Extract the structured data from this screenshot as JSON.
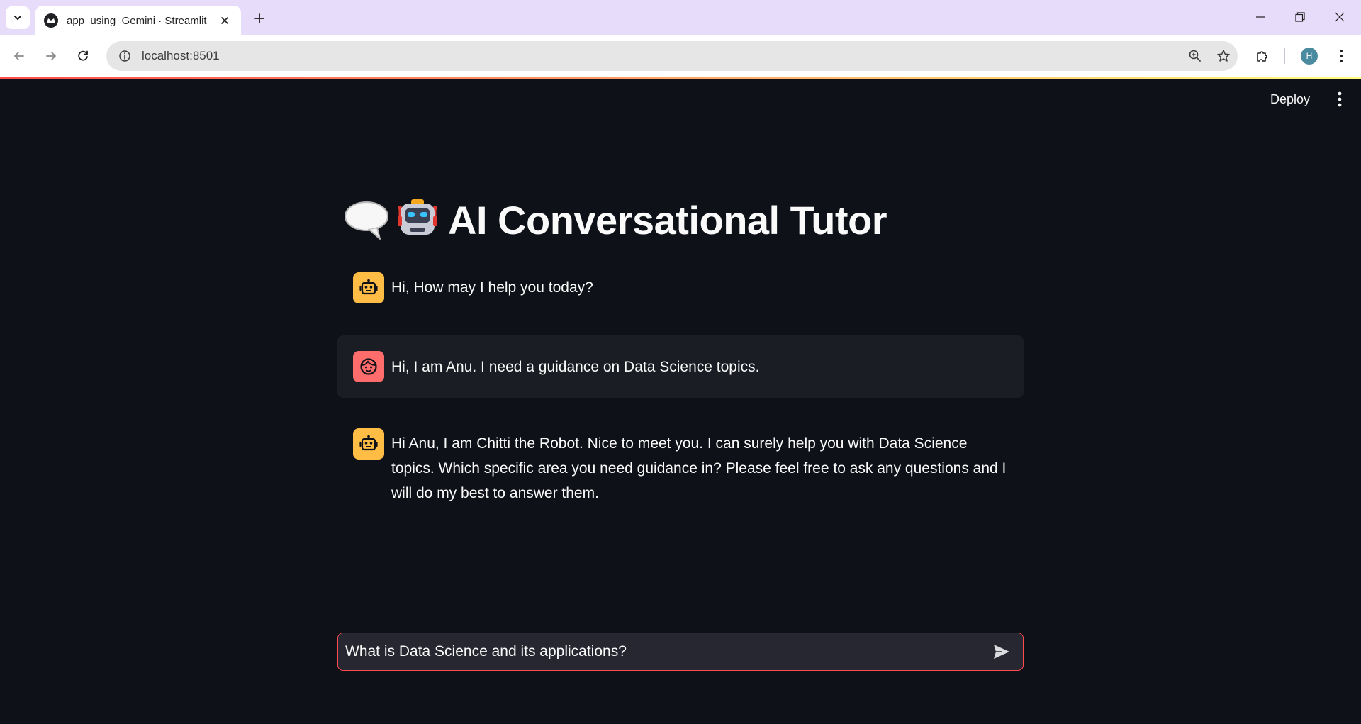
{
  "browser": {
    "tab_title": "app_using_Gemini · Streamlit",
    "url": "localhost:8501",
    "profile_initial": "H"
  },
  "app": {
    "deploy_label": "Deploy",
    "title": "AI Conversational Tutor",
    "title_icons": [
      "speech-balloon-icon",
      "robot-face-icon"
    ],
    "accent_color": "#ff4b4b",
    "assistant_avatar_color": "#ffbd45",
    "user_avatar_color": "#ff6c6c"
  },
  "chat": {
    "messages": [
      {
        "role": "assistant",
        "text": "Hi, How may I help you today?"
      },
      {
        "role": "user",
        "text": "Hi, I am Anu. I need a guidance on Data Science topics."
      },
      {
        "role": "assistant",
        "text": "Hi Anu, I am Chitti the Robot. Nice to meet you. I can surely help you with Data Science topics. Which specific area you need guidance in? Please feel free to ask any questions and I will do my best to answer them."
      }
    ],
    "input_value": "What is Data Science and its applications?"
  }
}
